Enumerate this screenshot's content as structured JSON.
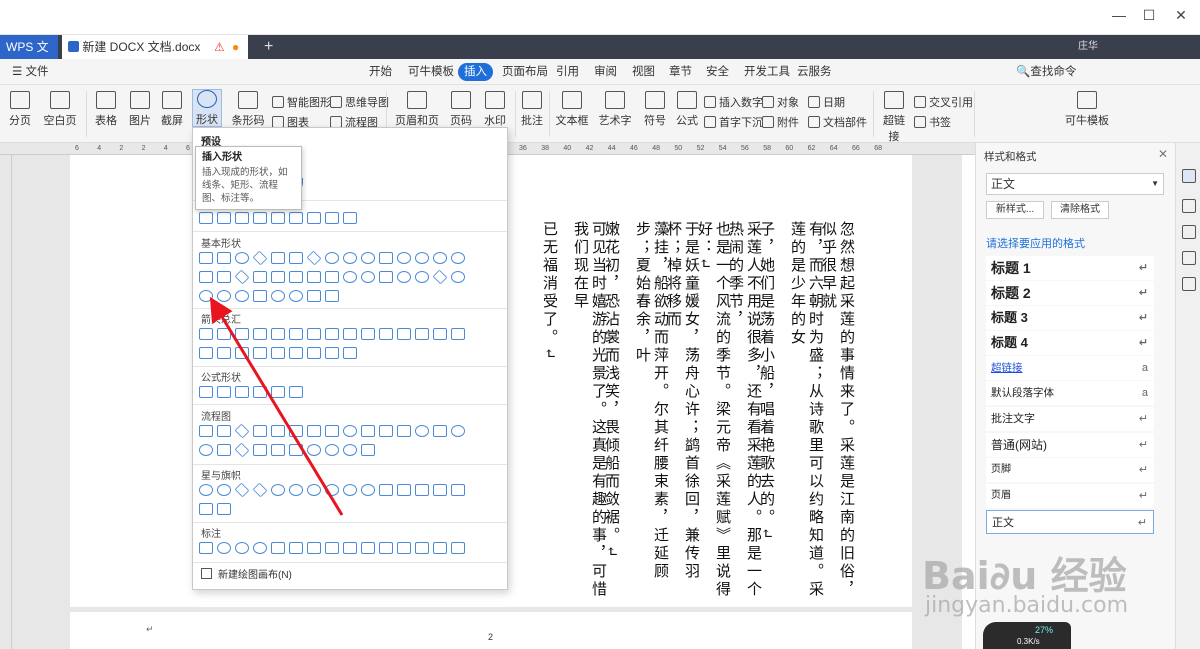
{
  "window": {
    "minimize": "—",
    "maximize": "☐",
    "close": "✕"
  },
  "tabs": {
    "app": "WPS 文字",
    "doc": "新建 DOCX 文档.docx",
    "add": "+",
    "user": "庄华"
  },
  "menu": {
    "file": "文件",
    "items": [
      "开始",
      "可牛模板",
      "插入",
      "页面布局",
      "引用",
      "审阅",
      "视图",
      "章节",
      "安全",
      "开发工具",
      "云服务"
    ],
    "active_index": 2,
    "search": "查找命令"
  },
  "ribbon": {
    "pagebreak": "分页",
    "blank": "空白页",
    "table": "表格",
    "picture": "图片",
    "screenshot": "截屏",
    "shapes": "形状",
    "iconlib": "图标库",
    "chart": "条形码",
    "smartart": "智能图形",
    "mindmap": "思维导图",
    "icon": "图表",
    "flow": "流程图",
    "header": "页眉和页脚",
    "pagenum": "页码",
    "watermark": "水印",
    "comment": "批注",
    "textbox": "文本框",
    "arttext": "艺术字",
    "symbol": "符号",
    "formula": "公式",
    "insertnum": "插入数字",
    "object": "对象",
    "date": "日期",
    "dropcap": "首字下沉",
    "attach": "附件",
    "docpart": "文档部件",
    "hyperlink": "超链接",
    "crossref": "交叉引用",
    "bookmark": "书签",
    "template": "可牛模板"
  },
  "ruler": {
    "h": [
      "6",
      "4",
      "2",
      "2",
      "4",
      "6",
      "8",
      "10",
      "12",
      "14",
      "16",
      "18",
      "20",
      "22",
      "24",
      "26",
      "28",
      "30",
      "32",
      "34",
      "36",
      "38",
      "40",
      "42",
      "44",
      "46",
      "48",
      "50",
      "52",
      "54",
      "56",
      "58",
      "60",
      "62",
      "64",
      "66",
      "68"
    ],
    "v": [
      "2",
      "1",
      "1",
      "2",
      "3",
      "4",
      "5",
      "6",
      "7",
      "8",
      "9",
      "10",
      "11",
      "12",
      "13",
      "14",
      "15",
      "16",
      "17",
      "18",
      "19",
      "20",
      "21",
      "22",
      "23"
    ]
  },
  "document": {
    "columns": [
      "忽然想起采莲的事情来了。采莲是江南的旧俗，似乎很早就",
      "有，而六朝时为盛；从诗歌里可以约略知道。采莲的是少年的女",
      "子，她们是荡着小船，唱着艳歌去的。↵",
      "采莲人不用说很多，还有看采莲的人。那是一个热闹的季节，",
      "也是一个风流的季节。梁元帝《采莲赋》里说得好：↵",
      "于是妖童媛女，荡舟心许；鹢首徐回，兼传羽杯；棹将移而",
      "藻挂，船欲动而萍开。尔其纤腰束素，迁延顾步；夏始春余，叶",
      "嫩花初，恐沾裳而浅笑，畏倾船而敛裾。↵",
      "可见当时嬉游的光景了。这真是有趣的事，可惜我们现在早",
      "已无福消受了。↵"
    ],
    "page_number": "2",
    "return_mark": "↵"
  },
  "shapes_menu": {
    "preset": "预设",
    "sections": [
      "基本形状",
      "箭头总汇",
      "公式形状",
      "流程图",
      "星与旗帜",
      "标注"
    ],
    "new_canvas": "新建绘图画布(N)"
  },
  "tooltip": {
    "title": "插入形状",
    "body": "插入现成的形状，如线条、矩形、流程图、标注等。"
  },
  "styles_panel": {
    "title": "样式和格式",
    "current": "正文",
    "new_style": "新样式...",
    "clear": "清除格式",
    "hint": "请选择要应用的格式",
    "items": [
      "标题 1",
      "标题 2",
      "标题 3",
      "标题 4",
      "超链接",
      "默认段落字体",
      "批注文字",
      "普通(网站)",
      "页脚",
      "页眉",
      "正文"
    ]
  },
  "watermark": {
    "logo": "Bai∂u 经验",
    "url": "jingyan.baidu.com"
  },
  "gauge": {
    "percent": "27%",
    "speed": "0.3K/s"
  },
  "colors": {
    "accent": "#1e6fd9",
    "tabbar": "#3a3f4d",
    "shape_stroke": "#4a8ad8",
    "arrow": "#e8141e"
  }
}
